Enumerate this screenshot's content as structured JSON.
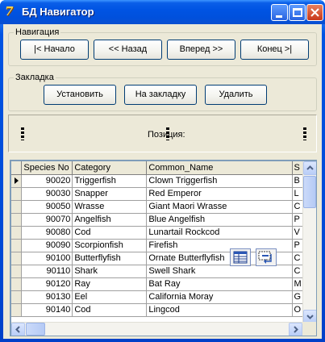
{
  "window": {
    "title": "БД Навигатор",
    "icon": "delphi-app-icon"
  },
  "navigation": {
    "label": "Навигация",
    "buttons": [
      "|< Начало",
      "<< Назад",
      "Вперед >>",
      "Конец >|"
    ]
  },
  "bookmark": {
    "label": "Закладка",
    "buttons": [
      "Установить",
      "На закладку",
      "Удалить"
    ]
  },
  "position": {
    "label": "Позиция:"
  },
  "grid": {
    "columns": [
      "Species No",
      "Category",
      "Common_Name",
      "S"
    ],
    "rows": [
      [
        "90020",
        "Triggerfish",
        "Clown Triggerfish",
        "B"
      ],
      [
        "90030",
        "Snapper",
        "Red Emperor",
        "L"
      ],
      [
        "90050",
        "Wrasse",
        "Giant Maori Wrasse",
        "C"
      ],
      [
        "90070",
        "Angelfish",
        "Blue Angelfish",
        "P"
      ],
      [
        "90080",
        "Cod",
        "Lunartail Rockcod",
        "V"
      ],
      [
        "90090",
        "Scorpionfish",
        "Firefish",
        "P"
      ],
      [
        "90100",
        "Butterflyfish",
        "Ornate Butterflyfish",
        "C"
      ],
      [
        "90110",
        "Shark",
        "Swell Shark",
        "C"
      ],
      [
        "90120",
        "Ray",
        "Bat Ray",
        "M"
      ],
      [
        "90130",
        "Eel",
        "California Moray",
        "G"
      ],
      [
        "90140",
        "Cod",
        "Lingcod",
        "O"
      ]
    ],
    "current_row": 0
  },
  "colors": {
    "title_bar": "#0054e3",
    "client_bg": "#ece9d8",
    "close_button": "#c8381a"
  }
}
